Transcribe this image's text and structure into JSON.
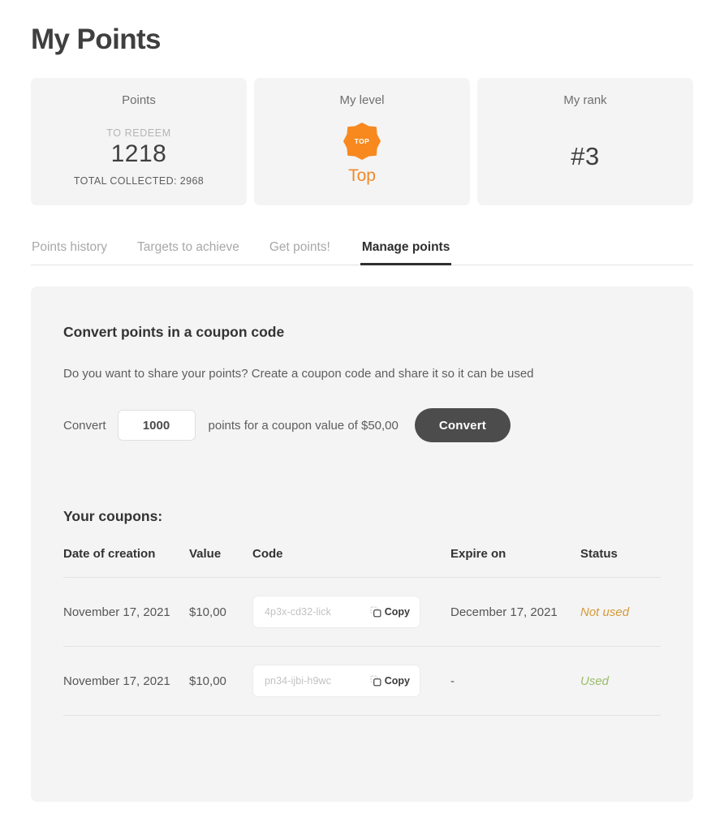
{
  "page": {
    "title": "My Points"
  },
  "stats": {
    "points": {
      "title": "Points",
      "sub_label": "TO REDEEM",
      "value": "1218",
      "total": "TOTAL COLLECTED: 2968"
    },
    "level": {
      "title": "My level",
      "badge_text": "TOP",
      "name": "Top",
      "accent_color": "#f08a2a"
    },
    "rank": {
      "title": "My rank",
      "value": "#3"
    }
  },
  "tabs": [
    {
      "label": "Points history",
      "active": false
    },
    {
      "label": "Targets to achieve",
      "active": false
    },
    {
      "label": "Get points!",
      "active": false
    },
    {
      "label": "Manage points",
      "active": true
    }
  ],
  "convert": {
    "heading": "Convert points in a coupon code",
    "description": "Do you want to share your points? Create a coupon code and share it so it can be used",
    "prefix_label": "Convert",
    "points_value": "1000",
    "points_placeholder": "1000",
    "suffix_label": "points for a coupon value of $50,00",
    "button_label": "Convert"
  },
  "coupons": {
    "heading": "Your coupons:",
    "columns": [
      "Date of creation",
      "Value",
      "Code",
      "Expire on",
      "Status"
    ],
    "copy_label": "Copy",
    "rows": [
      {
        "date": "November 17, 2021",
        "value": "$10,00",
        "code": "4p3x-cd32-lick",
        "expire": "December 17, 2021",
        "status": "Not used",
        "status_type": "not-used"
      },
      {
        "date": "November 17, 2021",
        "value": "$10,00",
        "code": "pn34-ijbi-h9wc",
        "expire": "-",
        "status": "Used",
        "status_type": "used"
      }
    ]
  },
  "colors": {
    "card_bg": "#f4f4f4",
    "panel_bg": "#f4f4f4",
    "accent_orange": "#f08a2a",
    "status_not_used": "#d49a3a",
    "status_used": "#9bbd6a",
    "button_dark": "#4c4c4c"
  }
}
